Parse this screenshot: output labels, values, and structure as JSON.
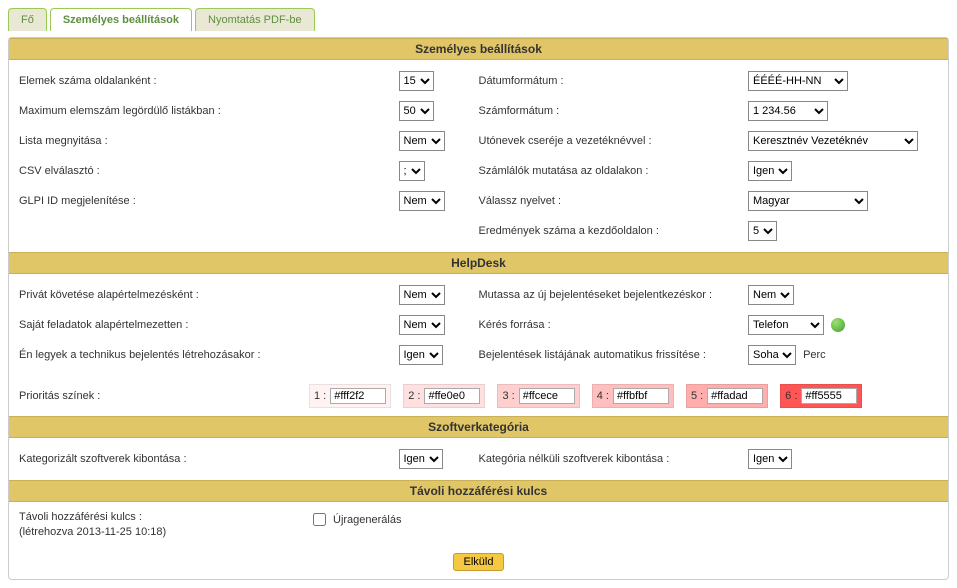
{
  "tabs": {
    "main": "Fő",
    "personal": "Személyes beállítások",
    "print": "Nyomtatás PDF-be"
  },
  "sections": {
    "personal": "Személyes beállítások",
    "helpdesk": "HelpDesk",
    "software": "Szoftverkategória",
    "remote": "Távoli hozzáférési kulcs"
  },
  "left": {
    "items_per_page": {
      "label": "Elemek száma oldalanként :",
      "value": "15"
    },
    "max_dropdown": {
      "label": "Maximum elemszám legördülő listákban :",
      "value": "50"
    },
    "open_list": {
      "label": "Lista megnyitása :",
      "value": "Nem"
    },
    "csv_sep": {
      "label": "CSV elválasztó :",
      "value": ";"
    },
    "glpi_id": {
      "label": "GLPI ID megjelenítése :",
      "value": "Nem"
    }
  },
  "right": {
    "date_fmt": {
      "label": "Dátumformátum :",
      "value": "ÉÉÉÉ-HH-NN"
    },
    "num_fmt": {
      "label": "Számformátum :",
      "value": "1 234.56"
    },
    "name_swap": {
      "label": "Utónevek cseréje a vezetéknévvel :",
      "value": "Keresztnév Vezetéknév"
    },
    "counters": {
      "label": "Számlálók mutatása az oldalakon :",
      "value": "Igen"
    },
    "language": {
      "label": "Válassz nyelvet :",
      "value": "Magyar"
    },
    "results_home": {
      "label": "Eredmények száma a kezdőoldalon :",
      "value": "5"
    }
  },
  "hd_left": {
    "private_follow": {
      "label": "Privát követése alapértelmezésként :",
      "value": "Nem"
    },
    "own_tasks": {
      "label": "Saját feladatok alapértelmezetten :",
      "value": "Nem"
    },
    "be_tech": {
      "label": "Én legyek a technikus bejelentés létrehozásakor :",
      "value": "Igen"
    }
  },
  "hd_right": {
    "show_new": {
      "label": "Mutassa az új bejelentéseket bejelentkezéskor :",
      "value": "Nem"
    },
    "req_src": {
      "label": "Kérés forrása :",
      "value": "Telefon"
    },
    "auto_refresh": {
      "label": "Bejelentések listájának automatikus frissítése :",
      "value": "Soha",
      "unit": "Perc"
    }
  },
  "priority": {
    "label": "Prioritás színek :",
    "items": [
      {
        "n": "1 :",
        "v": "#fff2f2",
        "bg": "#fff2f2"
      },
      {
        "n": "2 :",
        "v": "#ffe0e0",
        "bg": "#ffe0e0"
      },
      {
        "n": "3 :",
        "v": "#ffcece",
        "bg": "#ffcece"
      },
      {
        "n": "4 :",
        "v": "#ffbfbf",
        "bg": "#ffbfbf"
      },
      {
        "n": "5 :",
        "v": "#ffadad",
        "bg": "#ffadad"
      },
      {
        "n": "6 :",
        "v": "#ff5555",
        "bg": "#ff5555"
      }
    ]
  },
  "sw": {
    "cat_expand": {
      "label": "Kategorizált szoftverek kibontása :",
      "value": "Igen"
    },
    "nocat_expand": {
      "label": "Kategória nélküli szoftverek kibontása :",
      "value": "Igen"
    }
  },
  "remote": {
    "label": "Távoli hozzáférési kulcs :",
    "created": "(létrehozva 2013-11-25 10:18)",
    "regen": "Újragenerálás"
  },
  "submit": "Elküld"
}
